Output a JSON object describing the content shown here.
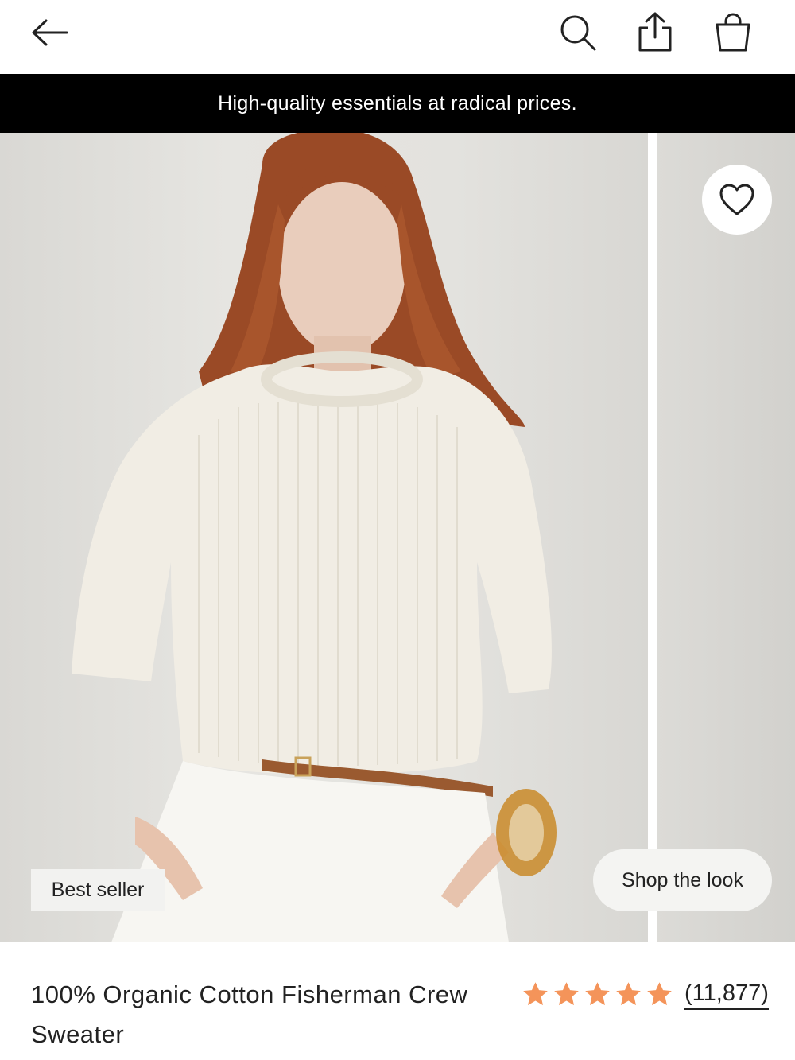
{
  "nav": {
    "back_icon": "arrow-left-icon",
    "search_icon": "search-icon",
    "share_icon": "share-icon",
    "bag_icon": "shopping-bag-icon"
  },
  "promo": {
    "text": "High-quality essentials at radical prices.",
    "background": "#000000",
    "color": "#ffffff"
  },
  "gallery": {
    "favorite_icon": "heart-icon",
    "badge": "Best seller",
    "shop_the_look": "Shop the look"
  },
  "product": {
    "title": "100% Organic Cotton Fisherman Crew Sweater",
    "rating": {
      "stars": 5,
      "max_stars": 5,
      "star_color": "#f4945a",
      "review_count": "(11,877)"
    }
  }
}
